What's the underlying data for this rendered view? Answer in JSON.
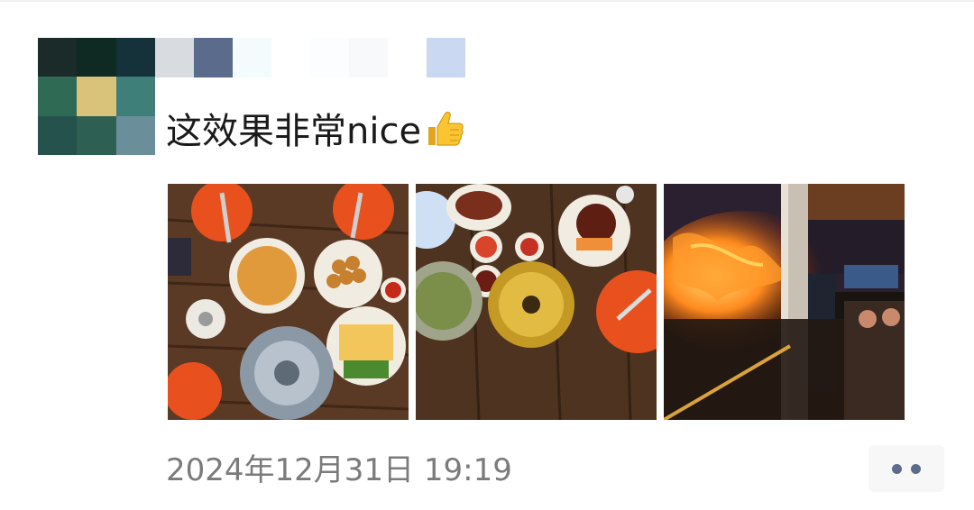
{
  "post": {
    "text": "这效果非常nice",
    "emoji": "thumbs-up-icon",
    "timestamp": "2024年12月31日 19:19"
  },
  "photos": [
    {
      "name": "food-table-photo-1",
      "subject": "thai-food-table-icon"
    },
    {
      "name": "food-table-photo-2",
      "subject": "hotpot-table-icon"
    },
    {
      "name": "fire-show-photo",
      "subject": "fire-performance-icon"
    }
  ],
  "more_button": {
    "icon": "ellipsis-icon"
  },
  "colors": {
    "text": "#1a1a1a",
    "timestamp": "#7b7b7b",
    "more_dots": "#5d6c8a",
    "more_bg": "#f7f7f7"
  }
}
